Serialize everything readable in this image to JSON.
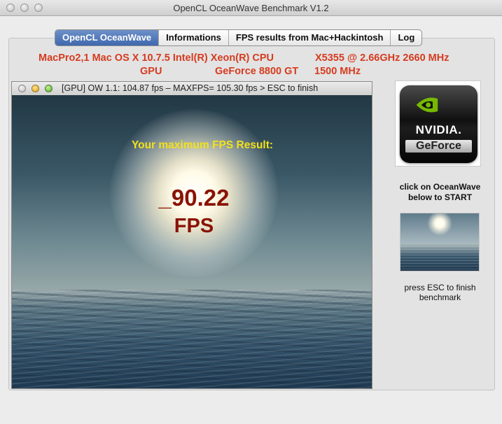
{
  "window": {
    "title": "OpenCL OceanWave Benchmark V1.2"
  },
  "tabs": [
    {
      "label": "OpenCL OceanWave",
      "active": true
    },
    {
      "label": "Informations",
      "active": false
    },
    {
      "label": "FPS results from Mac+Hackintosh",
      "active": false
    },
    {
      "label": "Log",
      "active": false
    }
  ],
  "system_info": {
    "machine": "MacPro2,1 Mac OS X 10.7.5 Intel(R) Xeon(R) CPU",
    "cpu_model": "X5355  @ 2.66GHz 2660 MHz",
    "gpu_label": "GPU",
    "gpu_model": "GeForce 8800 GT",
    "gpu_clock": "1500 MHz"
  },
  "gpu_window": {
    "title": "[GPU] OW 1.1: 104.87 fps – MAXFPS= 105.30 fps >  ESC to finish"
  },
  "result": {
    "label": "Your maximum FPS Result:",
    "value": "_90.22",
    "unit": "FPS"
  },
  "logo": {
    "brand": "NVIDIA.",
    "product": "GeForce"
  },
  "hints": {
    "start_line1": "click on OceanWave",
    "start_line2": "below to START",
    "finish_line1": "press ESC to finish",
    "finish_line2": "benchmark"
  },
  "colors": {
    "info_text": "#d63b1f",
    "result_label": "#f2e11a",
    "result_value": "#8a1204",
    "active_tab": "#4a74b8"
  }
}
